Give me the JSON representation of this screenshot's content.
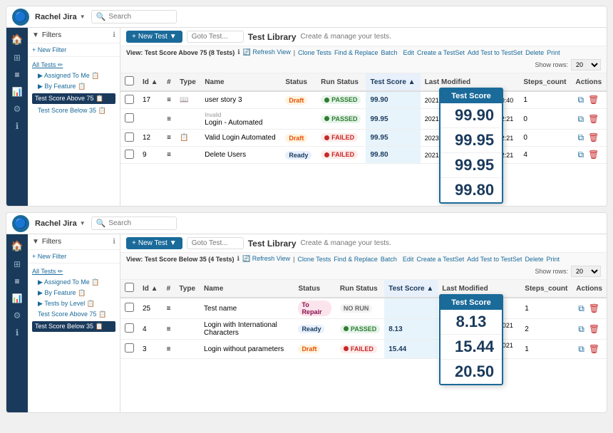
{
  "app": {
    "logo": "T",
    "project": "Rachel Jira",
    "search_placeholder": "Search"
  },
  "panel_top": {
    "new_test_btn": "New Test",
    "goto_placeholder": "Goto Test...",
    "page_title": "Test Library",
    "page_subtitle": "Create & manage your tests.",
    "view_label": "View: Test Score Above 75 (8 Tests)",
    "view_links": [
      "Refresh View",
      "Clone Tests",
      "Find & Replace",
      "Batch Edit",
      "Create a TestSet",
      "Add Test to TestSet",
      "Delete",
      "Print"
    ],
    "show_rows_label": "Show rows:",
    "show_rows_value": "20",
    "filter_label": "Filters",
    "new_filter_btn": "+ New Filter",
    "sidebar_links": [
      {
        "label": "All Tests",
        "type": "link"
      },
      {
        "label": "Assigned To Me",
        "type": "link"
      },
      {
        "label": "By Feature",
        "type": "link"
      },
      {
        "label": "Test Score Above 75",
        "type": "active"
      },
      {
        "label": "Test Score Below 35",
        "type": "link"
      }
    ],
    "table_headers": [
      "",
      "Id",
      "#",
      "Type",
      "Name",
      "Status",
      "Run Status",
      "Test Score",
      "Last Modified",
      "Steps_count",
      "Actions"
    ],
    "rows": [
      {
        "id": "17",
        "type": "story",
        "name": "user story 3",
        "status": "Draft",
        "run_status": "PASSED",
        "score": "99.90",
        "last_modified": "2021 12:44",
        "last_mod_date": "22-Nov-2021 10:40",
        "steps": "1"
      },
      {
        "id": "",
        "type": "",
        "name": "Login - Automated",
        "status": "",
        "run_status": "PASSED",
        "score": "99.95",
        "last_modified": "2021 12:21",
        "last_mod_date": "09-Nov-2021 12:21",
        "steps": "0",
        "tag": "Invalid"
      },
      {
        "id": "12",
        "type": "",
        "name": "Valid Login Automated",
        "status": "Draft",
        "run_status": "FAILED",
        "score": "99.95",
        "last_modified": "2023 10:48",
        "last_mod_date": "09-Nov-2021 12:21",
        "steps": "0"
      },
      {
        "id": "9",
        "type": "",
        "name": "Delete Users",
        "status": "Ready",
        "run_status": "FAILED",
        "score": "99.80",
        "last_modified": "2021 10:52",
        "last_mod_date": "09-Nov-2021 12:21",
        "steps": "4"
      }
    ],
    "score_overlay": {
      "header": "Test Score",
      "values": [
        "99.90",
        "99.95",
        "99.95",
        "99.80"
      ]
    }
  },
  "panel_bottom": {
    "new_test_btn": "New Test",
    "goto_placeholder": "Goto Test...",
    "page_title": "Test Library",
    "page_subtitle": "Create & manage your tests.",
    "view_label": "View: Test Score Below 35 (4 Tests)",
    "view_links": [
      "Refresh View",
      "Clone Tests",
      "Find & Replace",
      "Batch Edit",
      "Create a TestSet",
      "Add Test to TestSet",
      "Delete",
      "Print"
    ],
    "show_rows_label": "Show rows:",
    "show_rows_value": "20",
    "filter_label": "Filters",
    "new_filter_btn": "+ New Filter",
    "sidebar_links": [
      {
        "label": "All Tests",
        "type": "link"
      },
      {
        "label": "Assigned To Me",
        "type": "link"
      },
      {
        "label": "By Feature",
        "type": "link"
      },
      {
        "label": "Tests by Level",
        "type": "link"
      },
      {
        "label": "Test Score Above 75",
        "type": "link"
      },
      {
        "label": "Test Score Below 35",
        "type": "active"
      }
    ],
    "table_headers": [
      "",
      "Id",
      "#",
      "Type",
      "Name",
      "Status",
      "Run Status",
      "Test Score",
      "Last Modified",
      "Steps_count",
      "Actions"
    ],
    "rows": [
      {
        "id": "25",
        "type": "",
        "name": "Test name",
        "status": "To Repair",
        "run_status": "NO RUN",
        "score": "",
        "last_modified": "",
        "last_mod_date": "09-May-2023 14:43",
        "steps": "1"
      },
      {
        "id": "4",
        "type": "",
        "name": "Login with International Characters",
        "status": "Ready",
        "run_status": "PASSED",
        "score": "8.13",
        "last_modified": "2022 10:09",
        "last_mod_date": "07-Dec-2021 14:21",
        "steps": "2"
      },
      {
        "id": "3",
        "type": "",
        "name": "Login without parameters",
        "status": "Draft",
        "run_status": "FAILED",
        "score": "15.44",
        "last_modified": "2023 13:28",
        "last_mod_date": "09-Nov-2021 12:21",
        "steps": "1"
      }
    ],
    "score_overlay": {
      "header": "Test Score",
      "values": [
        "8.13",
        "15.44",
        "20.50"
      ]
    }
  }
}
